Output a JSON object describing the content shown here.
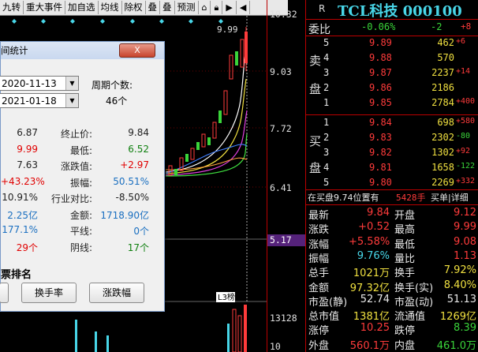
{
  "toolbar": {
    "items": [
      "九转",
      "重大事件",
      "加自选",
      "均线",
      "除权",
      "叠",
      "叠",
      "预测"
    ]
  },
  "axis": {
    "ticks": [
      "10.32",
      "9.03",
      "7.72",
      "6.41",
      "5.17",
      "13128",
      "10"
    ],
    "chart_top_label": "9.99",
    "mini_label": "L3榜",
    "crosshair_label": "5.17"
  },
  "quote": {
    "tag": "R",
    "title": "TCL科技 000100",
    "weibi_label": "委比",
    "weibi_pct": "-0.06%",
    "weibi_vol": "-2",
    "weibi_diff": "+8",
    "sell_label": [
      "卖",
      "盘"
    ],
    "buy_label": [
      "买",
      "盘"
    ],
    "sell": [
      {
        "n": "5",
        "price": "9.89",
        "vol": "462",
        "chg": "+6"
      },
      {
        "n": "4",
        "price": "9.88",
        "vol": "570",
        "chg": ""
      },
      {
        "n": "3",
        "price": "9.87",
        "vol": "2237",
        "chg": "+14"
      },
      {
        "n": "2",
        "price": "9.86",
        "vol": "2186",
        "chg": ""
      },
      {
        "n": "1",
        "price": "9.85",
        "vol": "2784",
        "chg": "+400"
      }
    ],
    "buy": [
      {
        "n": "1",
        "price": "9.84",
        "vol": "698",
        "chg": "+580"
      },
      {
        "n": "2",
        "price": "9.83",
        "vol": "2302",
        "chg": "-80"
      },
      {
        "n": "3",
        "price": "9.82",
        "vol": "1302",
        "chg": "+92"
      },
      {
        "n": "4",
        "price": "9.81",
        "vol": "1658",
        "chg": "-122"
      },
      {
        "n": "5",
        "price": "9.80",
        "vol": "2269",
        "chg": "+332"
      }
    ],
    "info_left": "在买盘9.74位置有",
    "info_vol": "5428手",
    "info_right": "买单|详细",
    "stats": [
      [
        "最新",
        "9.84",
        "red",
        "开盘",
        "9.12",
        "red"
      ],
      [
        "涨跌",
        "+0.52",
        "red",
        "最高",
        "9.99",
        "red"
      ],
      [
        "涨幅",
        "+5.58%",
        "red",
        "最低",
        "9.08",
        "red"
      ],
      [
        "振幅",
        "9.76%",
        "cyan",
        "量比",
        "1.13",
        "red"
      ],
      [
        "总手",
        "1021万",
        "yellow",
        "换手",
        "7.92%",
        "yellow"
      ],
      [
        "金额",
        "97.32亿",
        "yellow",
        "换手(实)",
        "8.40%",
        "yellow"
      ],
      [
        "市盈(静)",
        "52.74",
        "white",
        "市盈(动)",
        "51.13",
        "white"
      ],
      [
        "总市值",
        "1381亿",
        "yellow",
        "流通值",
        "1269亿",
        "yellow"
      ],
      [
        "涨停",
        "10.25",
        "red",
        "跌停",
        "8.39",
        "green"
      ],
      [
        "外盘",
        "560.1万",
        "red",
        "内盘",
        "461.0万",
        "green"
      ]
    ]
  },
  "dialog": {
    "title": "间统计",
    "close_label": "X",
    "start_date": "2020-11-13",
    "end_date": "2021-01-18",
    "period_label": "周期个数:",
    "period_value": "46个",
    "rows": [
      [
        "6.87",
        "gray",
        "终止价:",
        "9.84",
        "gray"
      ],
      [
        "9.99",
        "red",
        "最低:",
        "6.52",
        "green"
      ],
      [
        "7.63",
        "gray",
        "涨跌值:",
        "+2.97",
        "red"
      ],
      [
        "+43.23%",
        "red",
        "振幅:",
        "50.51%",
        "cyan"
      ],
      [
        "10.91%",
        "gray",
        "行业对比:",
        "-8.50%",
        "gray"
      ],
      [
        "2.25亿",
        "cyan",
        "金额:",
        "1718.90亿",
        "cyan"
      ],
      [
        "177.1%",
        "cyan",
        "平线:",
        "0个",
        "cyan"
      ],
      [
        "29个",
        "red",
        "阴线:",
        "17个",
        "green"
      ]
    ],
    "section_label": "票排名",
    "buttons": [
      "换手率",
      "涨跌幅"
    ]
  },
  "colors": {
    "up": "#ff3b3b",
    "down": "#3ad43a",
    "title": "#48d6e8",
    "crosshair": "#55227a"
  }
}
